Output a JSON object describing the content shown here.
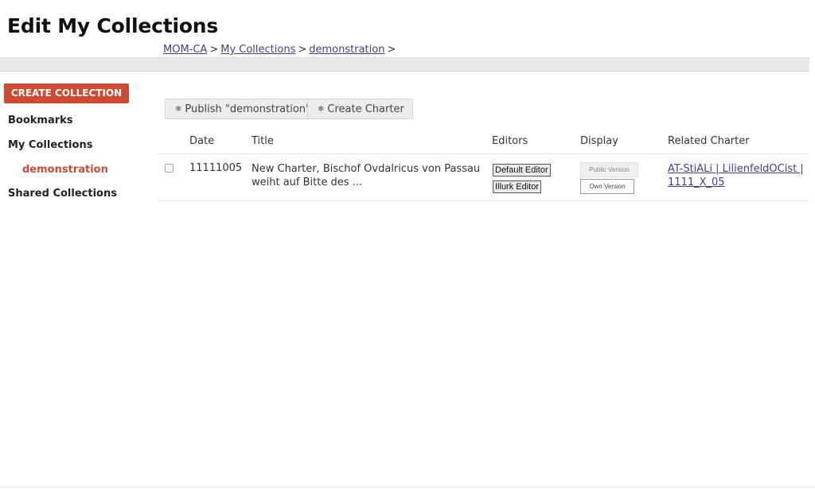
{
  "page": {
    "title": "Edit My Collections"
  },
  "breadcrumb": {
    "items": [
      "MOM-CA",
      "My Collections",
      "demonstration"
    ],
    "separator": ">"
  },
  "sidebar": {
    "create_label": "CREATE COLLECTION",
    "bookmarks": "Bookmarks",
    "my_collections": "My Collections",
    "sub_item": "demonstration",
    "shared_collections": "Shared Collections"
  },
  "toolbar": {
    "publish_label": "Publish \"demonstration\"",
    "create_charter_label": "Create Charter"
  },
  "table": {
    "headers": [
      "Date",
      "Title",
      "Editors",
      "Display",
      "Related Charter"
    ],
    "rows": [
      {
        "date": "11111005",
        "title": "New Charter, Bischof Ovdalricus von Passau weiht auf Bitte des ...",
        "editors": [
          "Default Editor",
          "Illurk Editor"
        ],
        "display": [
          "Public Version",
          "Own Version"
        ],
        "related": "AT-StiALi | LilienfeldOCist | 1111_X_05"
      }
    ]
  },
  "colors": {
    "accent": "#d04a33",
    "link": "#4a3a8a"
  },
  "icons": {
    "toolbar_button": "gear-icon"
  }
}
